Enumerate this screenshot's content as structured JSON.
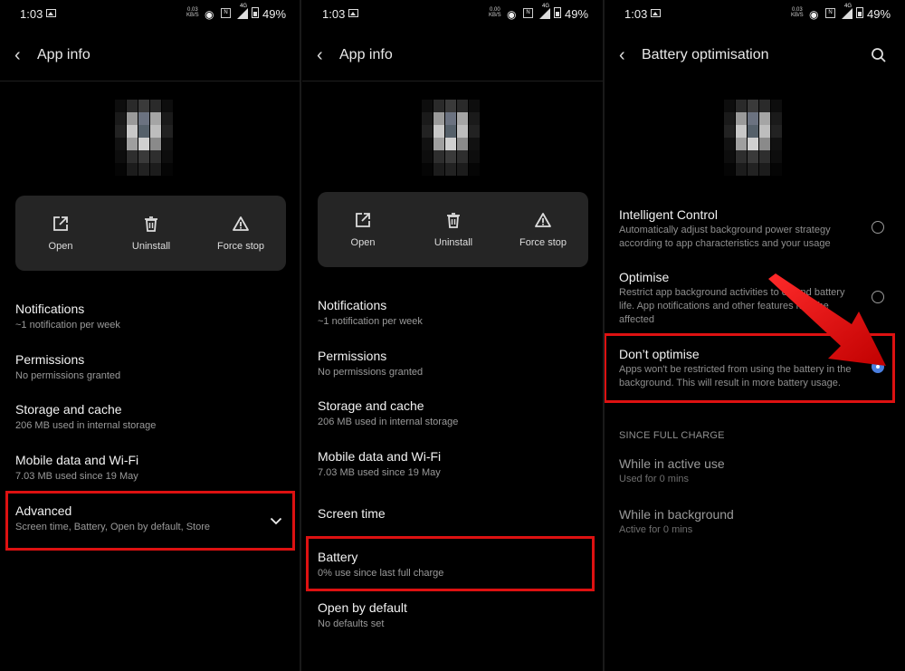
{
  "status_bar": {
    "time": "1:03",
    "net_speed_left": "0.03",
    "net_speed_center": "0.00",
    "net_unit": "KB/S",
    "signal": "4G",
    "battery": "49%"
  },
  "panel1": {
    "header_title": "App info",
    "actions": [
      {
        "label": "Open"
      },
      {
        "label": "Uninstall"
      },
      {
        "label": "Force stop"
      }
    ],
    "items": [
      {
        "title": "Notifications",
        "subtitle": "~1 notification per week"
      },
      {
        "title": "Permissions",
        "subtitle": "No permissions granted"
      },
      {
        "title": "Storage and cache",
        "subtitle": "206 MB used in internal storage"
      },
      {
        "title": "Mobile data and Wi-Fi",
        "subtitle": "7.03 MB used since 19 May"
      },
      {
        "title": "Advanced",
        "subtitle": "Screen time, Battery, Open by default, Store"
      }
    ]
  },
  "panel2": {
    "header_title": "App info",
    "actions": [
      {
        "label": "Open"
      },
      {
        "label": "Uninstall"
      },
      {
        "label": "Force stop"
      }
    ],
    "items": [
      {
        "title": "Notifications",
        "subtitle": "~1 notification per week"
      },
      {
        "title": "Permissions",
        "subtitle": "No permissions granted"
      },
      {
        "title": "Storage and cache",
        "subtitle": "206 MB used in internal storage"
      },
      {
        "title": "Mobile data and Wi-Fi",
        "subtitle": "7.03 MB used since 19 May"
      },
      {
        "title": "Screen time",
        "subtitle": ""
      },
      {
        "title": "Battery",
        "subtitle": "0% use since last full charge"
      },
      {
        "title": "Open by default",
        "subtitle": "No defaults set"
      }
    ]
  },
  "panel3": {
    "header_title": "Battery optimisation",
    "options": [
      {
        "title": "Intelligent Control",
        "subtitle": "Automatically adjust background power strategy according to app characteristics and your usage",
        "selected": false
      },
      {
        "title": "Optimise",
        "subtitle": "Restrict app background activities to extend battery life. App notifications and other features may be affected",
        "selected": false
      },
      {
        "title": "Don’t optimise",
        "subtitle": "Apps won't be restricted from using the battery in the background. This will result in more battery usage.",
        "selected": true
      }
    ],
    "section_label": "SINCE FULL CHARGE",
    "usage": [
      {
        "title": "While in active use",
        "subtitle": "Used for 0 mins"
      },
      {
        "title": "While in background",
        "subtitle": "Active for 0 mins"
      }
    ]
  },
  "colors": {
    "background": "#000000",
    "card": "#252525",
    "highlight": "#dd1111",
    "radio_selected": "#4a7fe0",
    "arrow": "#e01010"
  }
}
